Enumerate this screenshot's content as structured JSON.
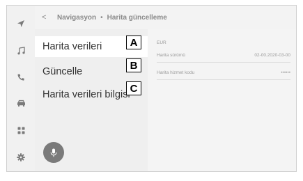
{
  "header": {
    "back_glyph": "<",
    "breadcrumb_parent": "Navigasyon",
    "breadcrumb_separator": "•",
    "breadcrumb_current": "Harita güncelleme"
  },
  "rail": {
    "items": [
      {
        "icon": "navigation-arrow-icon"
      },
      {
        "icon": "music-note-icon"
      },
      {
        "icon": "phone-icon"
      },
      {
        "icon": "car-icon"
      },
      {
        "icon": "apps-grid-icon"
      },
      {
        "icon": "settings-gear-icon"
      }
    ]
  },
  "menu": {
    "items": [
      {
        "label": "Harita verileri",
        "callout": "A",
        "selected": true
      },
      {
        "label": "Güncelle",
        "callout": "B",
        "selected": false
      },
      {
        "label": "Harita verileri bilgisi",
        "callout": "C",
        "selected": false
      }
    ]
  },
  "detail": {
    "region": "EUR",
    "rows": [
      {
        "label": "Harita sürümü",
        "value": "02-00.2020-03-00"
      },
      {
        "label": "Harita hizmet kodu",
        "value": "••••••"
      }
    ]
  },
  "voice": {
    "icon": "microphone-icon"
  },
  "colors": {
    "panel_bg": "#efefef",
    "selected_bg": "#ffffff",
    "text": "#333333",
    "muted": "#8a8a8a",
    "mic_bg": "#7a7a7a"
  }
}
